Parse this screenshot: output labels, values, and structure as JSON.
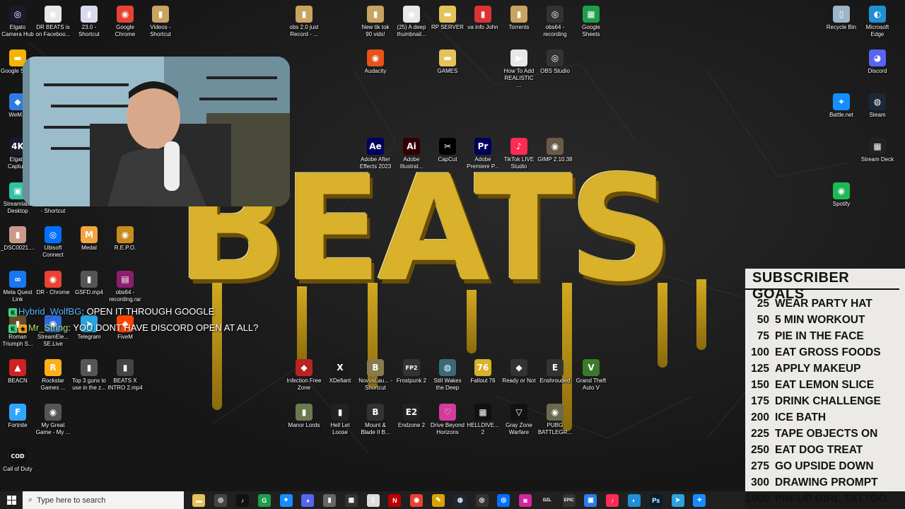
{
  "desktop_icons": [
    {
      "label": "Elgato Camera Hub",
      "glyph": "◎",
      "color": "#1a1a2e"
    },
    {
      "label": "DR BEATS is on Faceboo...",
      "glyph": "◉",
      "color": "#e8e8e8"
    },
    {
      "label": "23.0 - Shortcut",
      "glyph": "▮",
      "color": "#d9d9f0"
    },
    {
      "label": "Google Chrome",
      "glyph": "◉",
      "color": "#e94235"
    },
    {
      "label": "Videos - Shortcut",
      "glyph": "▮",
      "color": "#c8a460"
    },
    {
      "label": "obs 2.0 just Record - ...",
      "glyph": "▮",
      "color": "#c8a460"
    },
    {
      "label": "New tik tok 90 vids!",
      "glyph": "▮",
      "color": "#c8a460"
    },
    {
      "label": "(25) A deep thumbnail...",
      "glyph": "◉",
      "color": "#e8e8e8"
    },
    {
      "label": "RP SERVER",
      "glyph": "▬",
      "color": "#e6c25a"
    },
    {
      "label": "va info John",
      "glyph": "▮",
      "color": "#d33"
    },
    {
      "label": "Torrents",
      "glyph": "▮",
      "color": "#c8a460"
    },
    {
      "label": "obs64 - recording",
      "glyph": "◎",
      "color": "#333"
    },
    {
      "label": "Google Sheets",
      "glyph": "▦",
      "color": "#1e9e4a"
    },
    {
      "label": "Recycle Bin",
      "glyph": "▯",
      "color": "#9db5c8"
    },
    {
      "label": "Microsoft Edge",
      "glyph": "◐",
      "color": "#1f8fd6"
    },
    {
      "label": "Google Slid...",
      "glyph": "▬",
      "color": "#f4b400"
    },
    {
      "label": "Audacity",
      "glyph": "◉",
      "color": "#e8511a"
    },
    {
      "label": "GAMES",
      "glyph": "▬",
      "color": "#e6c25a"
    },
    {
      "label": "How To Add REALISTIC ...",
      "glyph": "▶",
      "color": "#e8e8e8"
    },
    {
      "label": "OBS Studio",
      "glyph": "◎",
      "color": "#333"
    },
    {
      "label": "Discord",
      "glyph": "◕",
      "color": "#5865f2"
    },
    {
      "label": "WeM...",
      "glyph": "◆",
      "color": "#2c7be5"
    },
    {
      "label": "Battle.net",
      "glyph": "✦",
      "color": "#148eff"
    },
    {
      "label": "Steam",
      "glyph": "◍",
      "color": "#1b2838"
    },
    {
      "label": "Elgato Captu...",
      "glyph": "4K",
      "color": "#1a1a2e"
    },
    {
      "label": "Adobe After Effects 2023",
      "glyph": "Ae",
      "color": "#00005b"
    },
    {
      "label": "Adobe Illustrat...",
      "glyph": "Ai",
      "color": "#330000"
    },
    {
      "label": "CapCut",
      "glyph": "✂",
      "color": "#000"
    },
    {
      "label": "Adobe Premiere P...",
      "glyph": "Pr",
      "color": "#00005b"
    },
    {
      "label": "TikTok LIVE Studio",
      "glyph": "♪",
      "color": "#fe2c55"
    },
    {
      "label": "GIMP 2.10.38",
      "glyph": "◉",
      "color": "#6a5a4a"
    },
    {
      "label": "Stream Deck",
      "glyph": "▦",
      "color": "#222"
    },
    {
      "label": "Streamlabs Desktop",
      "glyph": "▣",
      "color": "#31c3a2"
    },
    {
      "label": "OculusMirror - Shortcut",
      "glyph": "◉",
      "color": "#555"
    },
    {
      "label": "Spotify",
      "glyph": "◉",
      "color": "#1db954"
    },
    {
      "label": "_DSC0021....",
      "glyph": "▮",
      "color": "#c98"
    },
    {
      "label": "Ubisoft Connect",
      "glyph": "◎",
      "color": "#0070ff"
    },
    {
      "label": "Medal",
      "glyph": "M",
      "color": "#f2a541"
    },
    {
      "label": "R.E.P.O.",
      "glyph": "◉",
      "color": "#c98b1f"
    },
    {
      "label": "Meta Quest Link",
      "glyph": "∞",
      "color": "#1877f2"
    },
    {
      "label": "DR - Chrome",
      "glyph": "◉",
      "color": "#e94235"
    },
    {
      "label": "GSFD.mp4",
      "glyph": "▮",
      "color": "#555"
    },
    {
      "label": "obs64 - recording.rar",
      "glyph": "▤",
      "color": "#8b1e6e"
    },
    {
      "label": "Roman Triumph S...",
      "glyph": "▮",
      "color": "#6b4a2a"
    },
    {
      "label": "StreamEle... SE.Live",
      "glyph": "◉",
      "color": "#2d6cdf"
    },
    {
      "label": "Telegram",
      "glyph": "➤",
      "color": "#2aa3e0"
    },
    {
      "label": "FiveM",
      "glyph": "◆",
      "color": "#f40"
    },
    {
      "label": "BEACN",
      "glyph": "▲",
      "color": "#c22"
    },
    {
      "label": "Rockstar Games ...",
      "glyph": "R",
      "color": "#fcaf17"
    },
    {
      "label": "Top 3 guns to use in the z...",
      "glyph": "▮",
      "color": "#555"
    },
    {
      "label": "BEATS X INTRO 2.mp4",
      "glyph": "▮",
      "color": "#444"
    },
    {
      "label": "Infection Free Zone",
      "glyph": "◆",
      "color": "#b22"
    },
    {
      "label": "XDefiant",
      "glyph": "X",
      "color": "#1a1a1a"
    },
    {
      "label": "NovusLau... - Shortcut",
      "glyph": "B",
      "color": "#8a7a50"
    },
    {
      "label": "Frostpunk 2",
      "glyph": "FP2",
      "color": "#333"
    },
    {
      "label": "Still Wakes the Deep",
      "glyph": "◍",
      "color": "#3a6a7a"
    },
    {
      "label": "Fallout 76",
      "glyph": "76",
      "color": "#d9b12a"
    },
    {
      "label": "Ready or Not",
      "glyph": "◆",
      "color": "#333"
    },
    {
      "label": "Enshrouded",
      "glyph": "E",
      "color": "#333"
    },
    {
      "label": "Grand Theft Auto V",
      "glyph": "V",
      "color": "#3a7a2a"
    },
    {
      "label": "Fortnite",
      "glyph": "F",
      "color": "#2ea6ff"
    },
    {
      "label": "My Great Game - My ...",
      "glyph": "◉",
      "color": "#555"
    },
    {
      "label": "Manor Lords",
      "glyph": "▮",
      "color": "#6a7a50"
    },
    {
      "label": "Hell Let Loose",
      "glyph": "▮",
      "color": "#222"
    },
    {
      "label": "Mount & Blade II B...",
      "glyph": "B",
      "color": "#333"
    },
    {
      "label": "Endzone 2",
      "glyph": "E2",
      "color": "#222"
    },
    {
      "label": "Drive Beyond Horizons",
      "glyph": "♡",
      "color": "#d23c9a"
    },
    {
      "label": "HELLDIVE... 2",
      "glyph": "▦",
      "color": "#111"
    },
    {
      "label": "Gray Zone Warfare",
      "glyph": "▽",
      "color": "#111"
    },
    {
      "label": "PUBG BATTLEGR...",
      "glyph": "◉",
      "color": "#6a6a50"
    },
    {
      "label": "Call of Duty",
      "glyph": "COD",
      "color": "#111"
    }
  ],
  "wallpaper": {
    "title": "BEATS"
  },
  "chat": [
    {
      "user": "Hybrid_WolfBG",
      "message": "OPEN IT THROUGH GOOGLE"
    },
    {
      "user": "Mr_String",
      "message": "YOU DONT HAVE DISCORD OPEN AT ALL?"
    }
  ],
  "goals": {
    "title": "SUBSCRIBER GOALS",
    "items": [
      {
        "num": "25",
        "text": "WEAR PARTY HAT"
      },
      {
        "num": "50",
        "text": "5 MIN WORKOUT"
      },
      {
        "num": "75",
        "text": "PIE IN THE FACE"
      },
      {
        "num": "100",
        "text": "EAT GROSS FOODS"
      },
      {
        "num": "125",
        "text": "APPLY MAKEUP"
      },
      {
        "num": "150",
        "text": "EAT LEMON SLICE"
      },
      {
        "num": "175",
        "text": "DRINK CHALLENGE"
      },
      {
        "num": "200",
        "text": "ICE BATH"
      },
      {
        "num": "225",
        "text": "TAPE OBJECTS ON"
      },
      {
        "num": "250",
        "text": "EAT DOG TREAT"
      },
      {
        "num": "275",
        "text": "GO UPSIDE DOWN"
      },
      {
        "num": "300",
        "text": "DRAWING PROMPT"
      },
      {
        "num": "1000",
        "text": "PIN-UP GIRL TATTOO"
      }
    ]
  },
  "taskbar": {
    "search_placeholder": "Type here to search",
    "apps": [
      {
        "name": "file-explorer",
        "glyph": "▬",
        "color": "#e6c25a"
      },
      {
        "name": "obs",
        "glyph": "◎",
        "color": "#444"
      },
      {
        "name": "tiktok",
        "glyph": "♪",
        "color": "#111"
      },
      {
        "name": "chrome-g",
        "glyph": "G",
        "color": "#1e9e4a"
      },
      {
        "name": "battle-net",
        "glyph": "✦",
        "color": "#148eff"
      },
      {
        "name": "discord",
        "glyph": "◕",
        "color": "#5865f2"
      },
      {
        "name": "mic",
        "glyph": "▮",
        "color": "#666"
      },
      {
        "name": "stream-deck",
        "glyph": "▦",
        "color": "#333"
      },
      {
        "name": "notepad",
        "glyph": "▯",
        "color": "#ddd"
      },
      {
        "name": "netflix",
        "glyph": "N",
        "color": "#b00"
      },
      {
        "name": "chrome",
        "glyph": "◉",
        "color": "#e94235"
      },
      {
        "name": "pen",
        "glyph": "✎",
        "color": "#d9a400"
      },
      {
        "name": "steam",
        "glyph": "◍",
        "color": "#1b2838"
      },
      {
        "name": "elgato",
        "glyph": "◎",
        "color": "#333"
      },
      {
        "name": "ubisoft",
        "glyph": "◎",
        "color": "#0070ff"
      },
      {
        "name": "instagram",
        "glyph": "◙",
        "color": "#d6249f"
      },
      {
        "name": "dzl",
        "glyph": "DZL",
        "color": "#222"
      },
      {
        "name": "epic",
        "glyph": "EPIC",
        "color": "#333"
      },
      {
        "name": "photos",
        "glyph": "▣",
        "color": "#2b7de9"
      },
      {
        "name": "tiktok-live",
        "glyph": "♪",
        "color": "#fe2c55"
      },
      {
        "name": "edge",
        "glyph": "◐",
        "color": "#1f8fd6"
      },
      {
        "name": "photoshop",
        "glyph": "Ps",
        "color": "#001e36"
      },
      {
        "name": "telegram",
        "glyph": "➤",
        "color": "#2aa3e0"
      },
      {
        "name": "battle-net-2",
        "glyph": "✦",
        "color": "#148eff"
      }
    ]
  }
}
